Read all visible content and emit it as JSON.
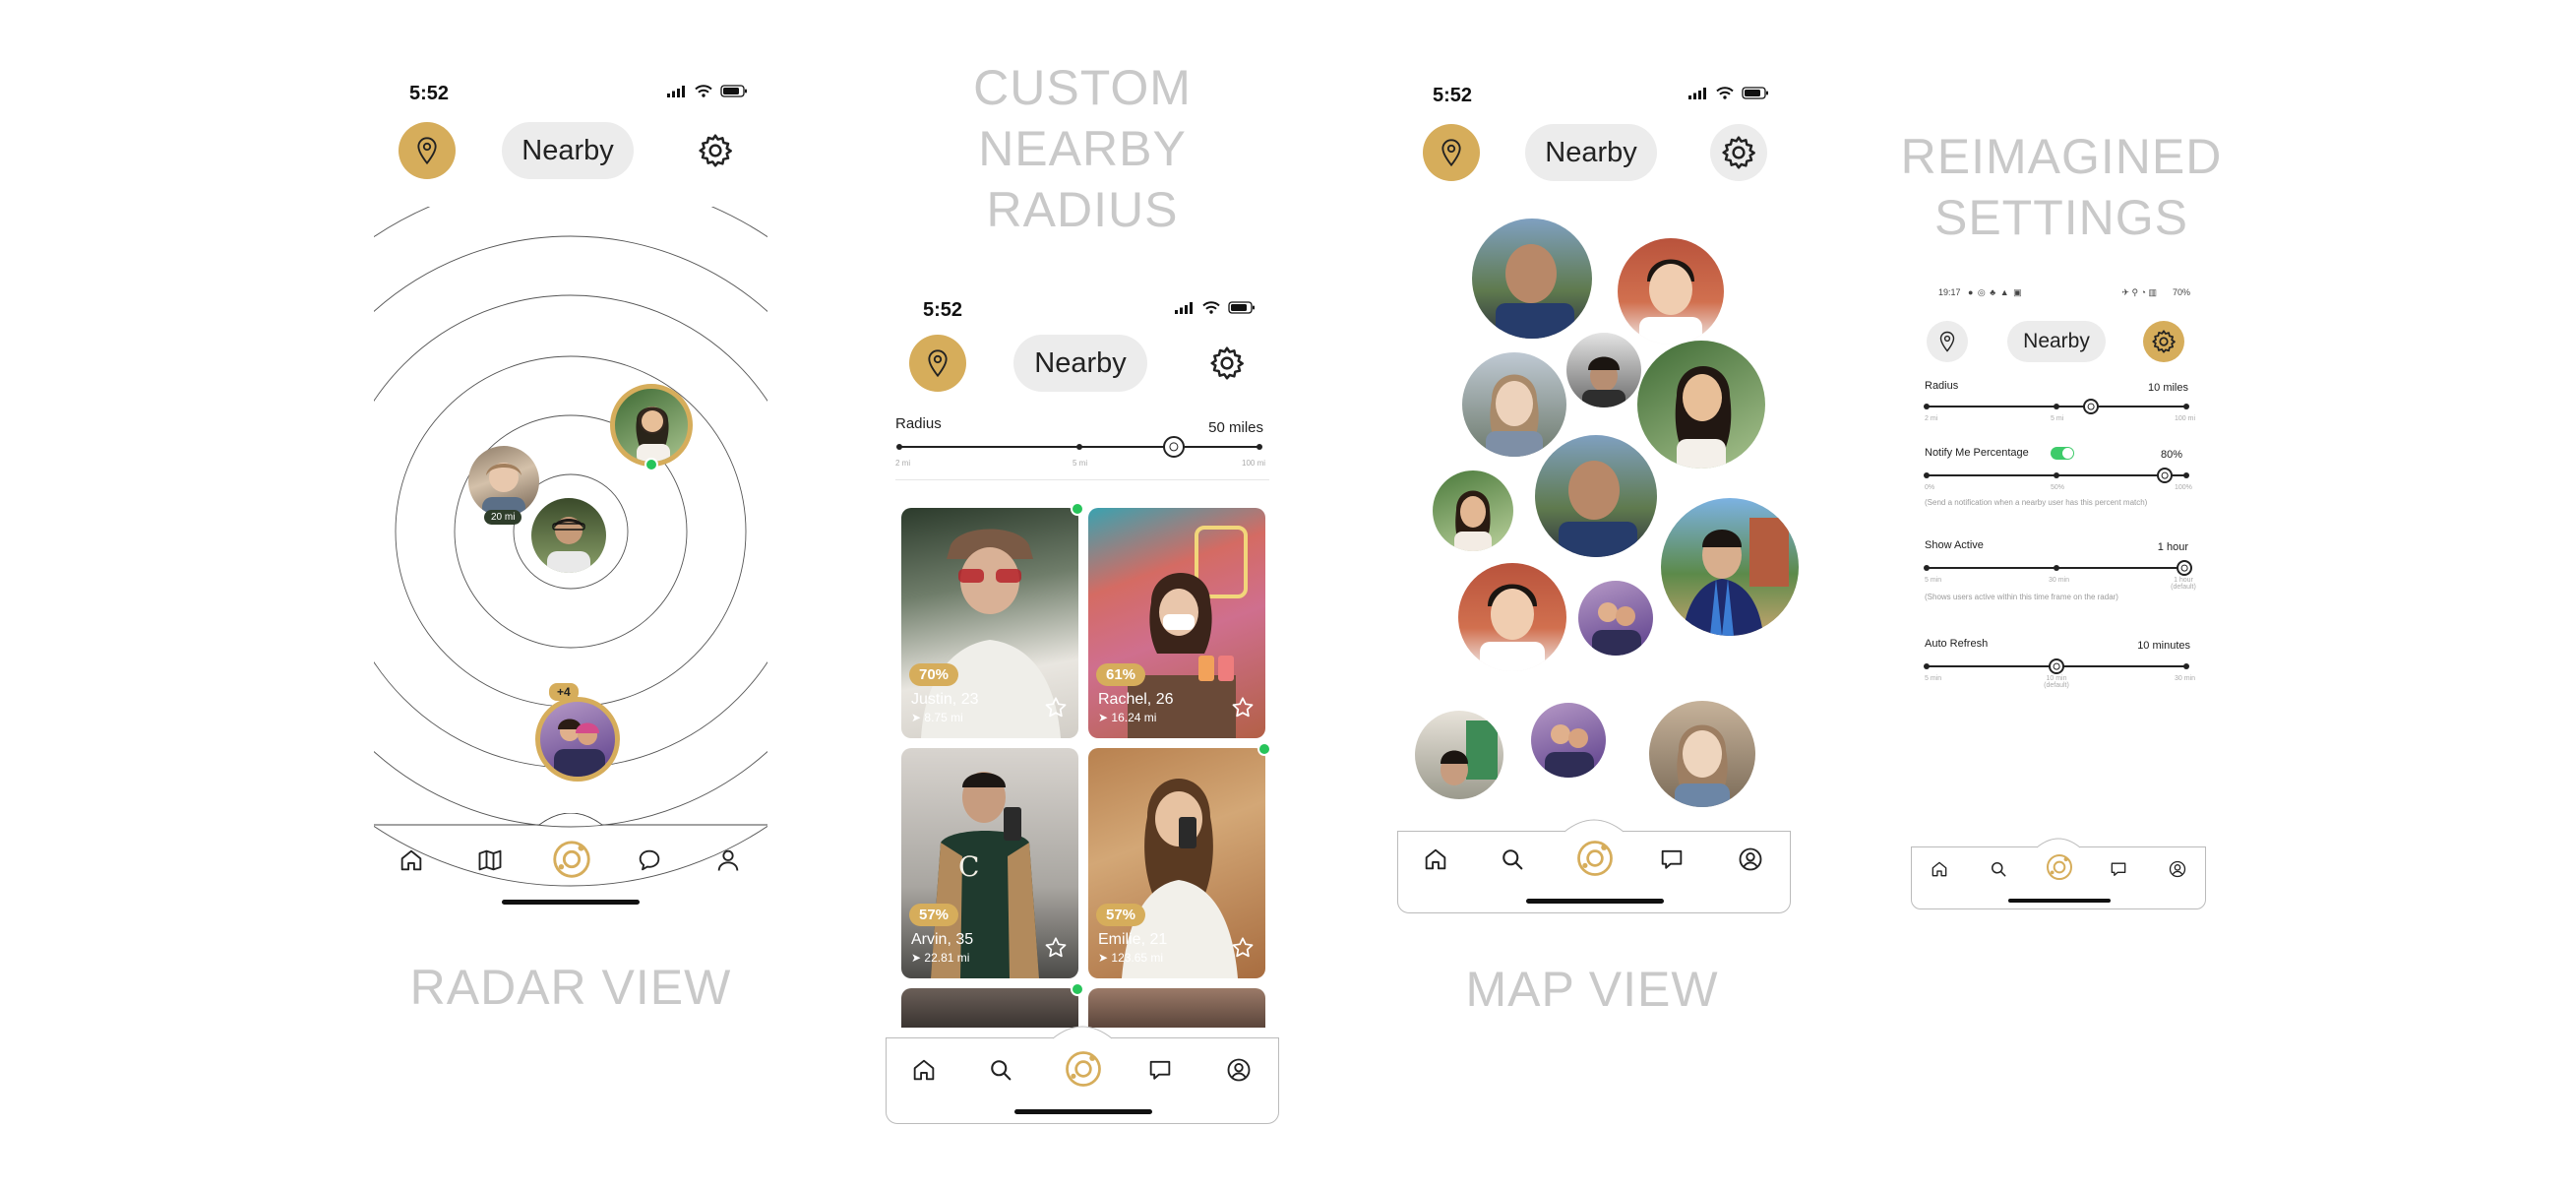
{
  "colors": {
    "accent": "#d6ad5b",
    "pill": "#ececec",
    "online": "#27c45a",
    "caption": "#c9c9c9"
  },
  "captions": {
    "radar": "RADAR VIEW",
    "custom": [
      "CUSTOM",
      "NEARBY",
      "RADIUS"
    ],
    "map": "MAP VIEW",
    "settings": [
      "REIMAGINED",
      "SETTINGS"
    ]
  },
  "header": {
    "nearby_label": "Nearby",
    "status_time": "5:52"
  },
  "radar": {
    "distance_tag": "20 mi",
    "plus_badge": "+4"
  },
  "radius_screen": {
    "radius_label": "Radius",
    "radius_value": "50 miles",
    "tick_labels": [
      "2 mi",
      "5 mi",
      "",
      "100 mi"
    ],
    "cards": [
      {
        "percent": "70%",
        "name": "Justin, 23",
        "distance": "8.75 mi"
      },
      {
        "percent": "61%",
        "name": "Rachel, 26",
        "distance": "16.24 mi"
      },
      {
        "percent": "57%",
        "name": "Arvin, 35",
        "distance": "22.81 mi"
      },
      {
        "percent": "57%",
        "name": "Emilie, 21",
        "distance": "123.65 mi"
      }
    ]
  },
  "settings_screen": {
    "status_time": "19:17",
    "status_battery": "70%",
    "radius": {
      "label": "Radius",
      "value": "10 miles",
      "ticks": [
        "2 mi",
        "5 mi",
        "100 mi"
      ]
    },
    "notify": {
      "label": "Notify Me Percentage",
      "value": "80%",
      "ticks": [
        "0%",
        "50%",
        "100%"
      ],
      "note": "(Send a notification when a nearby user has this percent match)"
    },
    "show_active": {
      "label": "Show Active",
      "value": "1 hour",
      "ticks": [
        "5 min",
        "30 min",
        "1 hour (default)"
      ],
      "note": "(Shows users active within this time frame on the radar)"
    },
    "auto_refresh": {
      "label": "Auto Refresh",
      "value": "10 minutes",
      "ticks": [
        "5 min",
        "10 min (default)",
        "30 min"
      ]
    }
  },
  "icons": {
    "location": "location-pin-icon",
    "settings": "gear-icon",
    "home": "home-icon",
    "map": "map-icon",
    "radar": "radar-icon",
    "chat": "chat-bubble-icon",
    "profile": "profile-icon",
    "search": "search-icon",
    "star": "star-icon"
  }
}
